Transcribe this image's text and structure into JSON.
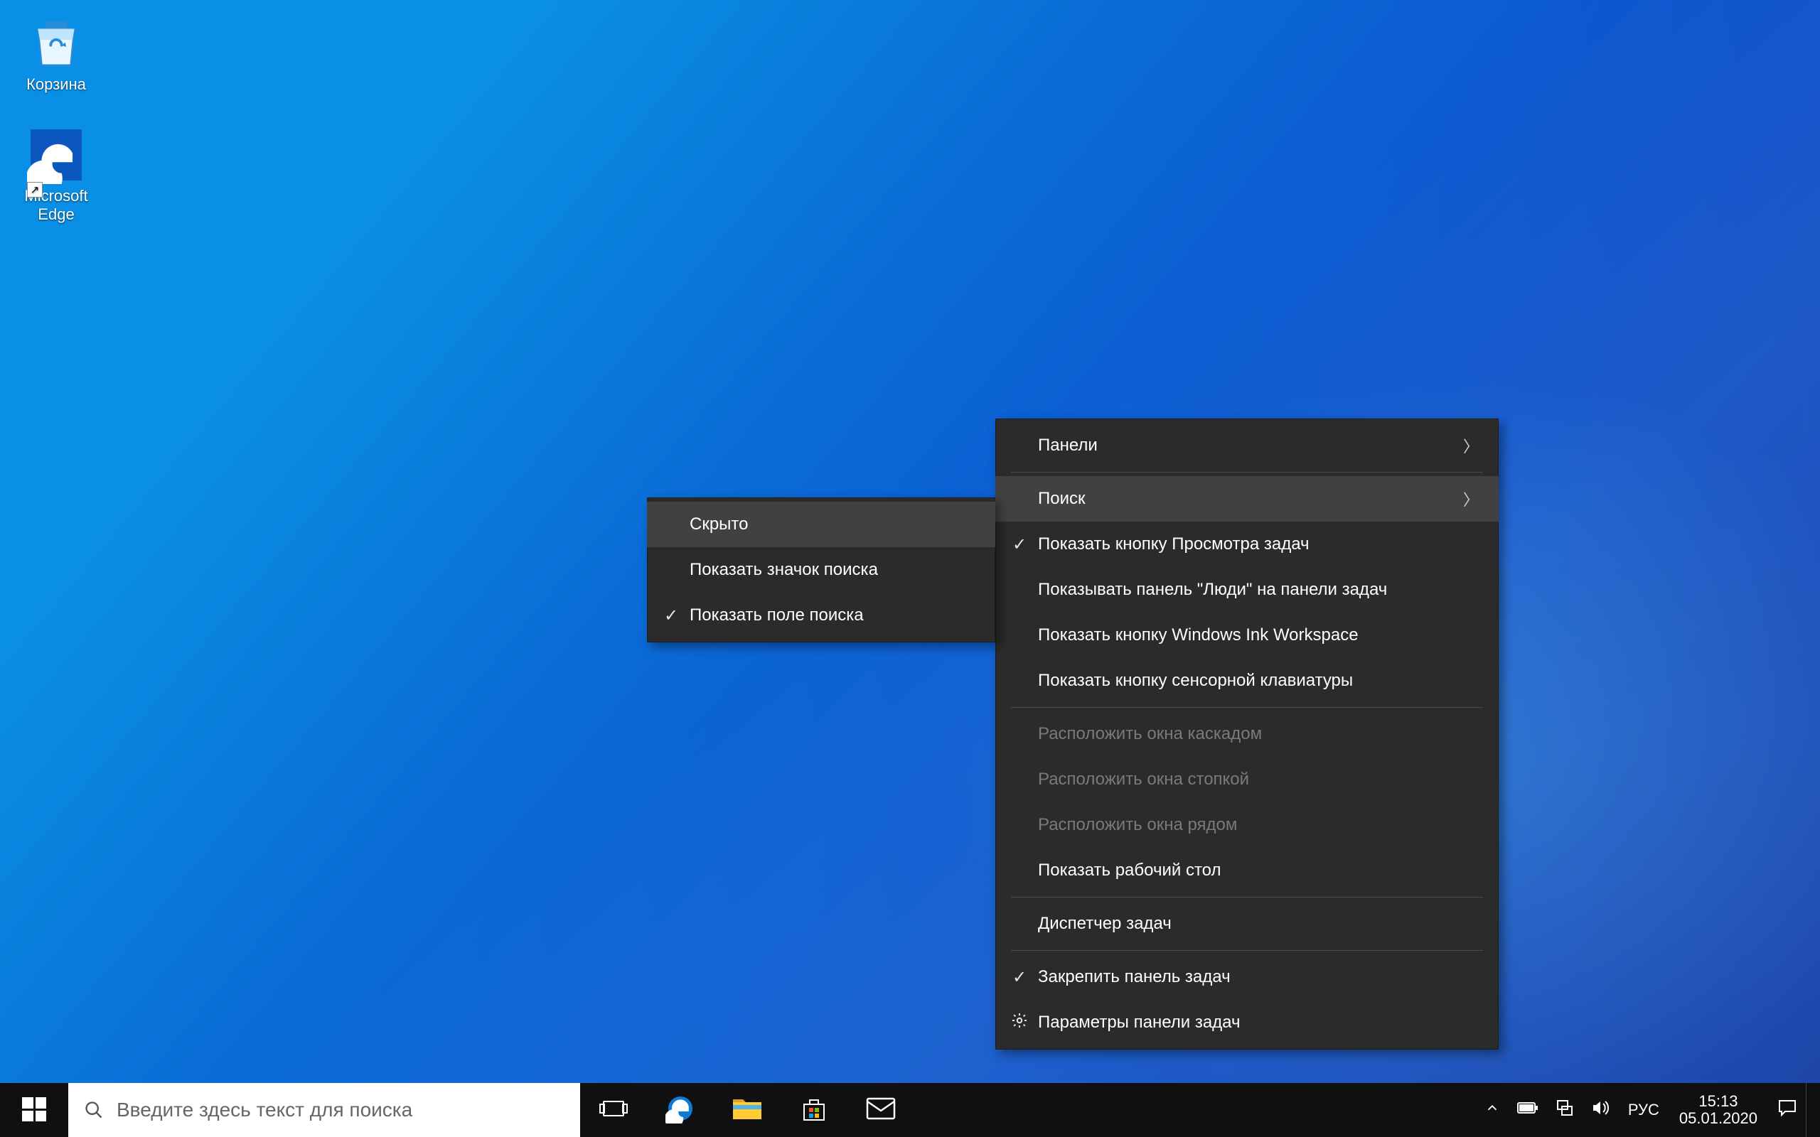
{
  "desktop": {
    "icons": [
      {
        "id": "recycle-bin",
        "label": "Корзина",
        "shortcut": false
      },
      {
        "id": "microsoft-edge",
        "label": "Microsoft Edge",
        "shortcut": true
      }
    ]
  },
  "contextMenu": {
    "main": [
      {
        "label": "Панели",
        "submenu": true
      },
      {
        "sep": true
      },
      {
        "label": "Поиск",
        "submenu": true,
        "hover": true
      },
      {
        "label": "Показать кнопку Просмотра задач",
        "checked": true
      },
      {
        "label": "Показывать панель \"Люди\" на панели задач"
      },
      {
        "label": "Показать кнопку Windows Ink Workspace"
      },
      {
        "label": "Показать кнопку сенсорной клавиатуры"
      },
      {
        "sep": true
      },
      {
        "label": "Расположить окна каскадом",
        "disabled": true
      },
      {
        "label": "Расположить окна стопкой",
        "disabled": true
      },
      {
        "label": "Расположить окна рядом",
        "disabled": true
      },
      {
        "label": "Показать рабочий стол"
      },
      {
        "sep": true
      },
      {
        "label": "Диспетчер задач"
      },
      {
        "sep": true
      },
      {
        "label": "Закрепить панель задач",
        "checked": true
      },
      {
        "label": "Параметры панели задач",
        "leadingIcon": "gear"
      }
    ],
    "sub": [
      {
        "label": "Скрыто",
        "hover": true
      },
      {
        "label": "Показать значок поиска"
      },
      {
        "label": "Показать поле поиска",
        "checked": true
      }
    ]
  },
  "taskbar": {
    "searchPlaceholder": "Введите здесь текст для поиска",
    "pinned": [
      "task-view",
      "edge",
      "file-explorer",
      "microsoft-store",
      "mail"
    ]
  },
  "tray": {
    "language": "РУС",
    "time": "15:13",
    "date": "05.01.2020"
  }
}
